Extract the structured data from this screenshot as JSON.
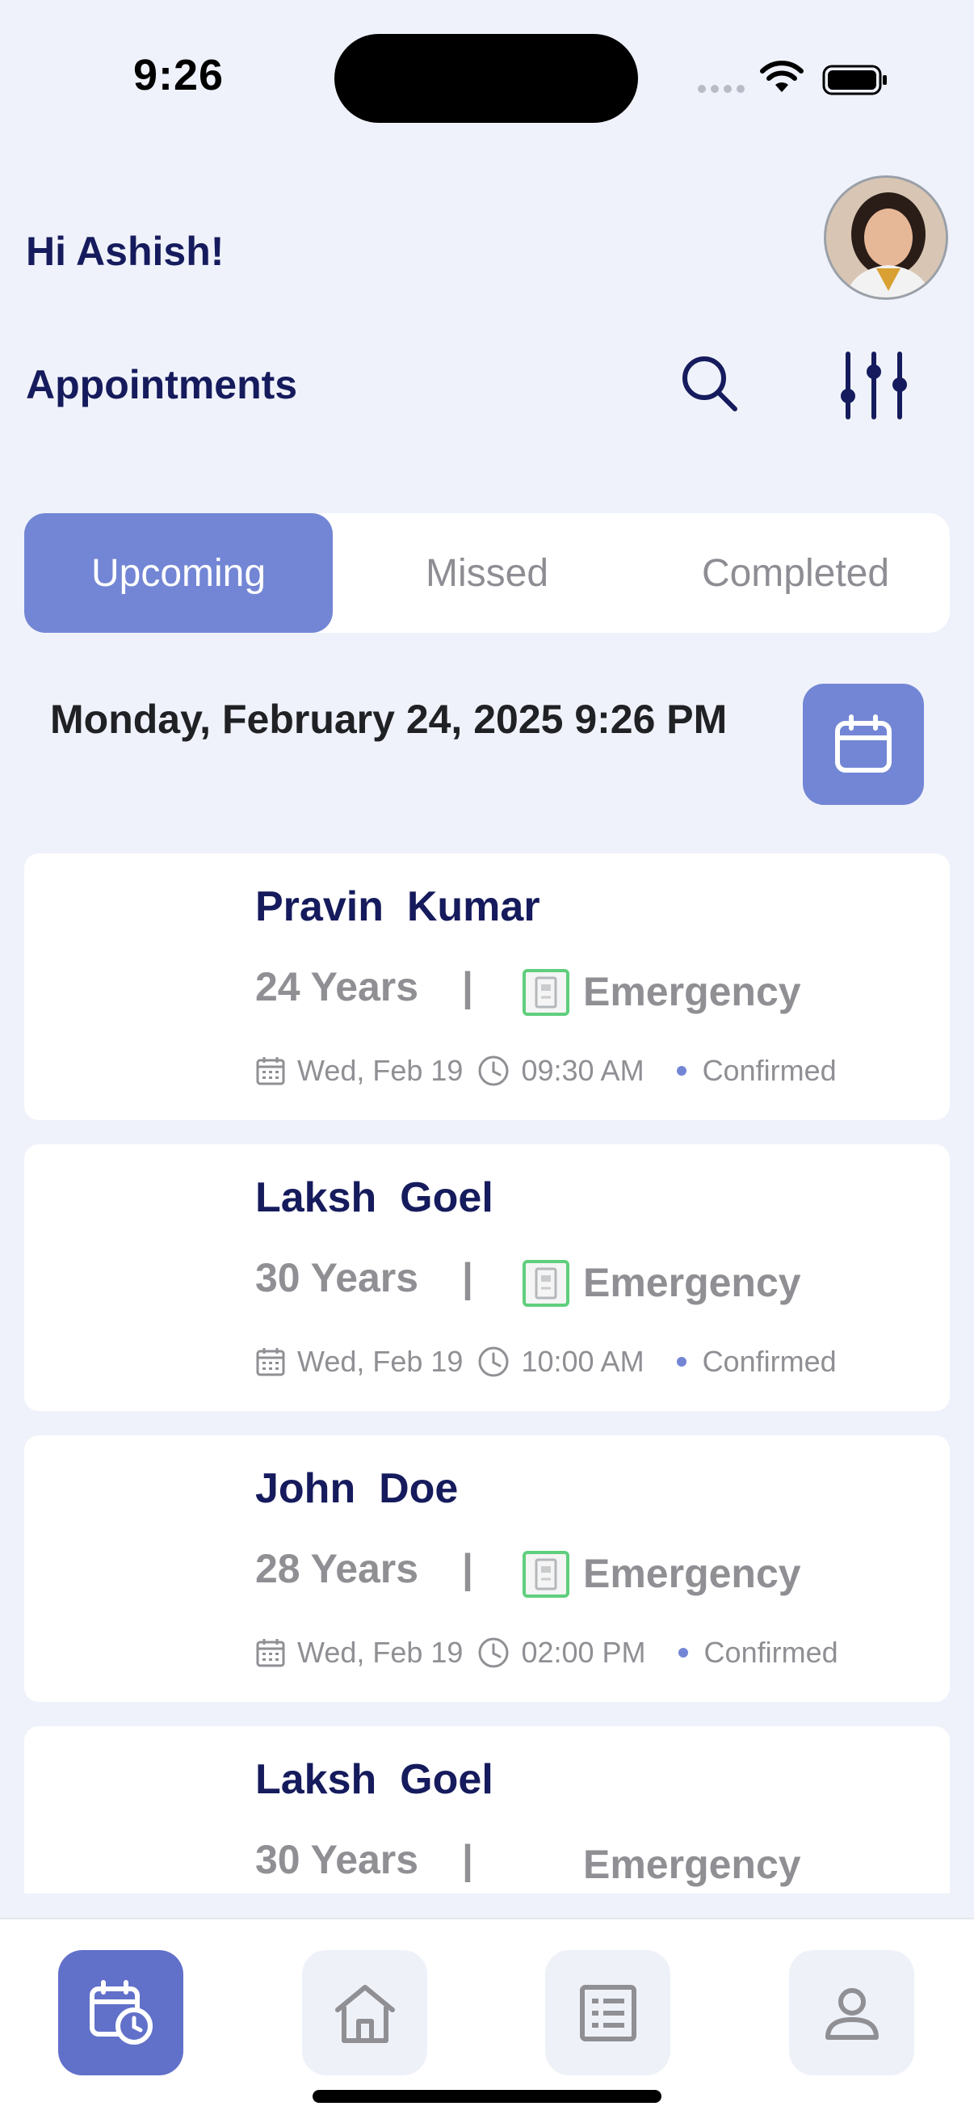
{
  "status_bar": {
    "time": "9:26"
  },
  "header": {
    "greeting": "Hi Ashish!",
    "section_title": "Appointments",
    "icons": [
      "search-icon",
      "filter-sliders-icon"
    ]
  },
  "tabs": [
    {
      "label": "Upcoming",
      "active": true
    },
    {
      "label": "Missed",
      "active": false
    },
    {
      "label": "Completed",
      "active": false
    }
  ],
  "current_datetime": "Monday, February 24, 2025 9:26 PM",
  "appointments": [
    {
      "name": "Pravin  Kumar",
      "age": "24 Years",
      "separator": "|",
      "type": "Emergency",
      "date": "Wed, Feb 19",
      "time": "09:30 AM",
      "status": "Confirmed"
    },
    {
      "name": "Laksh  Goel",
      "age": "30 Years",
      "separator": "|",
      "type": "Emergency",
      "date": "Wed, Feb 19",
      "time": "10:00 AM",
      "status": "Confirmed"
    },
    {
      "name": "John  Doe",
      "age": "28 Years",
      "separator": "|",
      "type": "Emergency",
      "date": "Wed, Feb 19",
      "time": "02:00 PM",
      "status": "Confirmed"
    },
    {
      "name": "Laksh  Goel",
      "age": "30 Years",
      "separator": "|",
      "type": "Emergency",
      "date": "",
      "time": "",
      "status": ""
    }
  ],
  "bottom_nav": [
    {
      "icon": "calendar-clock-icon",
      "active": true
    },
    {
      "icon": "home-icon",
      "active": false
    },
    {
      "icon": "list-icon",
      "active": false
    },
    {
      "icon": "profile-icon",
      "active": false
    }
  ],
  "colors": {
    "background": "#eff2fa",
    "accent": "#7386d5",
    "nav_active": "#6170c9",
    "title_text": "#151b5c",
    "muted_text": "#8f8f94",
    "emergency_icon": "#5fcf7d"
  }
}
